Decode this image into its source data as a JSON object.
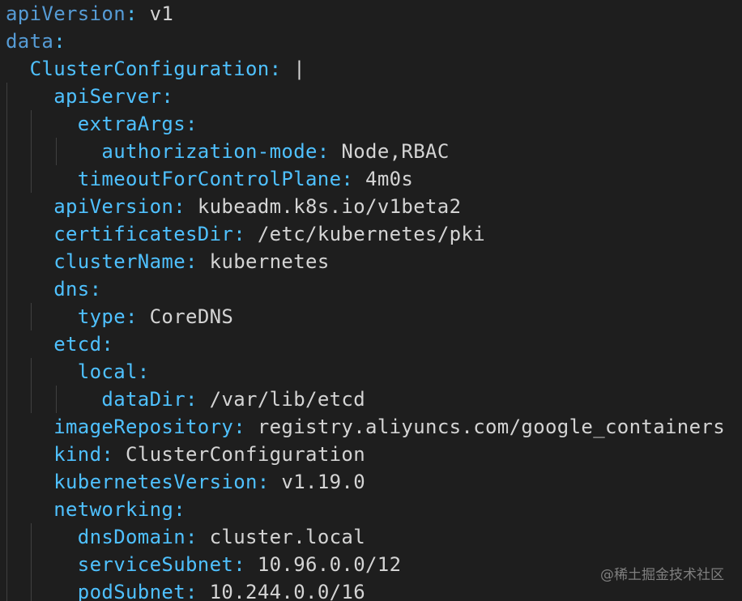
{
  "editor": {
    "background": "#1e1e1e",
    "key_color": "#4fc1ff",
    "value_color": "#d4d4d4",
    "lines": [
      {
        "indent": 0,
        "key": "apiVersion",
        "value": "v1"
      },
      {
        "indent": 0,
        "key": "data",
        "value": ""
      },
      {
        "indent": 1,
        "key": "ClusterConfiguration",
        "value": "|"
      },
      {
        "indent": 2,
        "key": "apiServer",
        "value": ""
      },
      {
        "indent": 3,
        "key": "extraArgs",
        "value": ""
      },
      {
        "indent": 4,
        "key": "authorization-mode",
        "value": "Node,RBAC"
      },
      {
        "indent": 3,
        "key": "timeoutForControlPlane",
        "value": "4m0s"
      },
      {
        "indent": 2,
        "key": "apiVersion",
        "value": "kubeadm.k8s.io/v1beta2"
      },
      {
        "indent": 2,
        "key": "certificatesDir",
        "value": "/etc/kubernetes/pki"
      },
      {
        "indent": 2,
        "key": "clusterName",
        "value": "kubernetes"
      },
      {
        "indent": 2,
        "key": "dns",
        "value": ""
      },
      {
        "indent": 3,
        "key": "type",
        "value": "CoreDNS"
      },
      {
        "indent": 2,
        "key": "etcd",
        "value": ""
      },
      {
        "indent": 3,
        "key": "local",
        "value": ""
      },
      {
        "indent": 4,
        "key": "dataDir",
        "value": "/var/lib/etcd"
      },
      {
        "indent": 2,
        "key": "imageRepository",
        "value": "registry.aliyuncs.com/google_containers"
      },
      {
        "indent": 2,
        "key": "kind",
        "value": "ClusterConfiguration"
      },
      {
        "indent": 2,
        "key": "kubernetesVersion",
        "value": "v1.19.0"
      },
      {
        "indent": 2,
        "key": "networking",
        "value": ""
      },
      {
        "indent": 3,
        "key": "dnsDomain",
        "value": "cluster.local"
      },
      {
        "indent": 3,
        "key": "serviceSubnet",
        "value": "10.96.0.0/12"
      },
      {
        "indent": 3,
        "key": "podSubnet",
        "value": "10.244.0.0/16"
      }
    ]
  },
  "watermark": {
    "text": "@稀土掘金技术社区"
  }
}
